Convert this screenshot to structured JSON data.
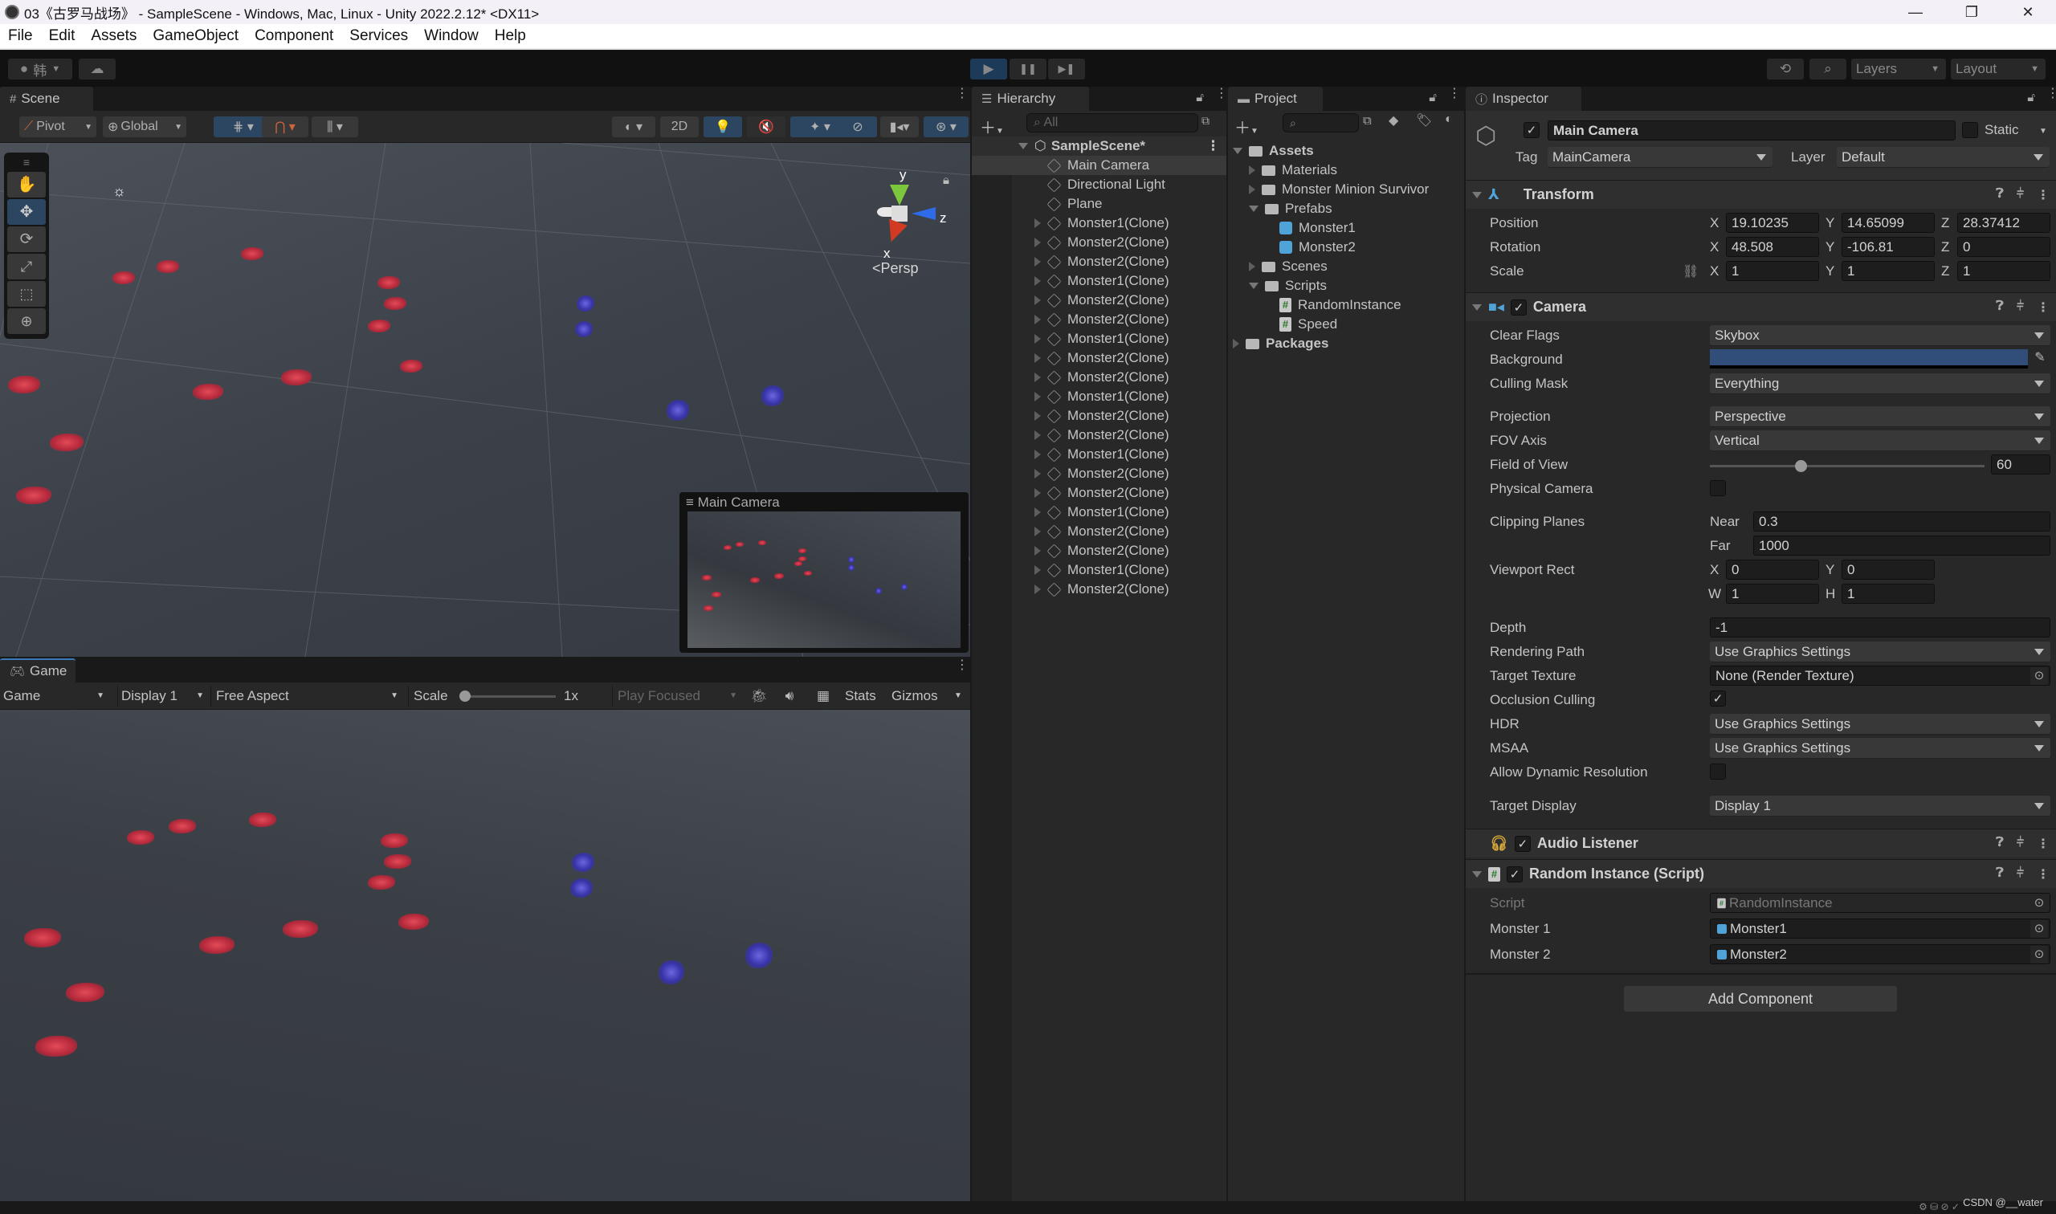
{
  "window": {
    "title": "03《古罗马战场》 - SampleScene - Windows, Mac, Linux - Unity 2022.2.12* <DX11>",
    "minimize": "—",
    "maximize": "❐",
    "close": "✕"
  },
  "menu": [
    "File",
    "Edit",
    "Assets",
    "GameObject",
    "Component",
    "Services",
    "Window",
    "Help"
  ],
  "toolbar": {
    "account_label": "韩",
    "play_icon": "▶",
    "pause_icon": "❚❚",
    "step_icon": "▶❚",
    "history_icon": "⟲",
    "search_icon": "⌕",
    "layers": "Layers",
    "layout": "Layout"
  },
  "scene": {
    "tab": "Scene",
    "pivot": "Pivot",
    "global": "Global",
    "btn_2d": "2D",
    "persp": "Persp",
    "gizmo_axes": {
      "x": "x",
      "y": "y",
      "z": "z"
    },
    "camera_preview_title": "Main Camera",
    "tools": [
      "hand",
      "move",
      "rotate",
      "scale",
      "rect",
      "transform"
    ]
  },
  "game": {
    "tab": "Game",
    "mode": "Game",
    "display": "Display 1",
    "aspect": "Free Aspect",
    "scale_label": "Scale",
    "scale_value": "1x",
    "scale_fraction": 0.0,
    "play_focused": "Play Focused",
    "stats": "Stats",
    "gizmos": "Gizmos"
  },
  "hierarchy": {
    "tab": "Hierarchy",
    "search_placeholder": "All",
    "scene_name": "SampleScene*",
    "items": [
      {
        "name": "Main Camera",
        "expandable": false,
        "selected": true
      },
      {
        "name": "Directional Light",
        "expandable": false
      },
      {
        "name": "Plane",
        "expandable": false
      },
      {
        "name": "Monster1(Clone)",
        "expandable": true
      },
      {
        "name": "Monster2(Clone)",
        "expandable": true
      },
      {
        "name": "Monster2(Clone)",
        "expandable": true
      },
      {
        "name": "Monster1(Clone)",
        "expandable": true
      },
      {
        "name": "Monster2(Clone)",
        "expandable": true
      },
      {
        "name": "Monster2(Clone)",
        "expandable": true
      },
      {
        "name": "Monster1(Clone)",
        "expandable": true
      },
      {
        "name": "Monster2(Clone)",
        "expandable": true
      },
      {
        "name": "Monster2(Clone)",
        "expandable": true
      },
      {
        "name": "Monster1(Clone)",
        "expandable": true
      },
      {
        "name": "Monster2(Clone)",
        "expandable": true
      },
      {
        "name": "Monster2(Clone)",
        "expandable": true
      },
      {
        "name": "Monster1(Clone)",
        "expandable": true
      },
      {
        "name": "Monster2(Clone)",
        "expandable": true
      },
      {
        "name": "Monster2(Clone)",
        "expandable": true
      },
      {
        "name": "Monster1(Clone)",
        "expandable": true
      },
      {
        "name": "Monster2(Clone)",
        "expandable": true
      },
      {
        "name": "Monster2(Clone)",
        "expandable": true
      },
      {
        "name": "Monster1(Clone)",
        "expandable": true
      },
      {
        "name": "Monster2(Clone)",
        "expandable": true
      }
    ]
  },
  "project": {
    "tab": "Project",
    "tree": [
      {
        "name": "Assets",
        "depth": 0,
        "type": "folder-open",
        "bold": true
      },
      {
        "name": "Materials",
        "depth": 1,
        "type": "folder"
      },
      {
        "name": "Monster Minion Survivor",
        "depth": 1,
        "type": "folder"
      },
      {
        "name": "Prefabs",
        "depth": 1,
        "type": "folder-open"
      },
      {
        "name": "Monster1",
        "depth": 2,
        "type": "prefab"
      },
      {
        "name": "Monster2",
        "depth": 2,
        "type": "prefab"
      },
      {
        "name": "Scenes",
        "depth": 1,
        "type": "folder"
      },
      {
        "name": "Scripts",
        "depth": 1,
        "type": "folder-open"
      },
      {
        "name": "RandomInstance",
        "depth": 2,
        "type": "script"
      },
      {
        "name": "Speed",
        "depth": 2,
        "type": "script"
      },
      {
        "name": "Packages",
        "depth": 0,
        "type": "folder",
        "bold": true
      }
    ]
  },
  "inspector": {
    "tab": "Inspector",
    "object_name": "Main Camera",
    "active": true,
    "static_label": "Static",
    "tag_label": "Tag",
    "tag": "MainCamera",
    "layer_label": "Layer",
    "layer": "Default",
    "transform": {
      "title": "Transform",
      "position_label": "Position",
      "rotation_label": "Rotation",
      "scale_label": "Scale",
      "position": {
        "x": "19.10235",
        "y": "14.65099",
        "z": "28.37412"
      },
      "rotation": {
        "x": "48.508",
        "y": "-106.81",
        "z": "0"
      },
      "scale": {
        "x": "1",
        "y": "1",
        "z": "1"
      }
    },
    "camera": {
      "title": "Camera",
      "clear_flags_label": "Clear Flags",
      "clear_flags": "Skybox",
      "background_label": "Background",
      "background_color": "#314d79",
      "culling_mask_label": "Culling Mask",
      "culling_mask": "Everything",
      "projection_label": "Projection",
      "projection": "Perspective",
      "fov_axis_label": "FOV Axis",
      "fov_axis": "Vertical",
      "fov_label": "Field of View",
      "fov": "60",
      "fov_fraction": 0.33,
      "physical_label": "Physical Camera",
      "clipping_label": "Clipping Planes",
      "near_label": "Near",
      "near": "0.3",
      "far_label": "Far",
      "far": "1000",
      "viewport_label": "Viewport Rect",
      "vx": "0",
      "vy": "0",
      "vw": "1",
      "vh": "1",
      "depth_label": "Depth",
      "depth": "-1",
      "rendering_path_label": "Rendering Path",
      "rendering_path": "Use Graphics Settings",
      "target_texture_label": "Target Texture",
      "target_texture": "None (Render Texture)",
      "occlusion_label": "Occlusion Culling",
      "hdr_label": "HDR",
      "hdr": "Use Graphics Settings",
      "msaa_label": "MSAA",
      "msaa": "Use Graphics Settings",
      "dynres_label": "Allow Dynamic Resolution",
      "target_display_label": "Target Display",
      "target_display": "Display 1"
    },
    "audio_listener": {
      "title": "Audio Listener"
    },
    "random_instance": {
      "title": "Random Instance (Script)",
      "script_label": "Script",
      "script": "RandomInstance",
      "monster1_label": "Monster 1",
      "monster1": "Monster1",
      "monster2_label": "Monster 2",
      "monster2": "Monster2"
    },
    "add_component": "Add Component"
  },
  "status": {
    "watermark": "CSDN @__water"
  },
  "colors": {
    "accent_blue": "#2c4560",
    "prefab": "#4fa3d6",
    "panel": "#282828"
  }
}
